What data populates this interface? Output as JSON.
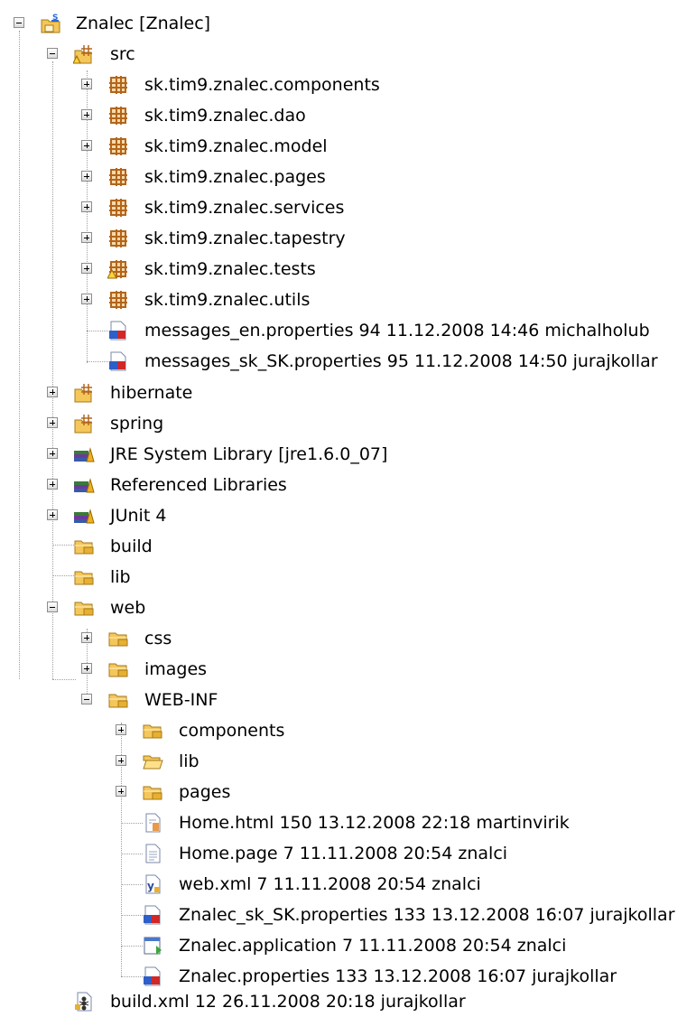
{
  "tree": {
    "root": {
      "label": "Znalec [Znalec]",
      "icon": "java-project-icon"
    },
    "src": {
      "label": "src",
      "icon": "source-folder-icon"
    },
    "packages": [
      {
        "label": "sk.tim9.znalec.components",
        "icon": "package-icon"
      },
      {
        "label": "sk.tim9.znalec.dao",
        "icon": "package-icon"
      },
      {
        "label": "sk.tim9.znalec.model",
        "icon": "package-icon"
      },
      {
        "label": "sk.tim9.znalec.pages",
        "icon": "package-icon"
      },
      {
        "label": "sk.tim9.znalec.services",
        "icon": "package-icon"
      },
      {
        "label": "sk.tim9.znalec.tapestry",
        "icon": "package-icon"
      },
      {
        "label": "sk.tim9.znalec.tests",
        "icon": "package-warning-icon"
      },
      {
        "label": "sk.tim9.znalec.utils",
        "icon": "package-icon"
      }
    ],
    "src_files": [
      {
        "label": "messages_en.properties 94  11.12.2008 14:46  michalholub",
        "icon": "properties-file-icon"
      },
      {
        "label": "messages_sk_SK.properties 95  11.12.2008 14:50  jurajkollar",
        "icon": "properties-file-icon"
      }
    ],
    "hibernate": {
      "label": "hibernate",
      "icon": "source-folder-icon"
    },
    "spring": {
      "label": "spring",
      "icon": "source-folder-icon"
    },
    "jre": {
      "label": "JRE System Library [jre1.6.0_07]",
      "icon": "library-icon"
    },
    "reflibs": {
      "label": "Referenced Libraries",
      "icon": "library-icon"
    },
    "junit": {
      "label": "JUnit 4",
      "icon": "library-icon"
    },
    "build": {
      "label": "build",
      "icon": "folder-icon"
    },
    "lib": {
      "label": "lib",
      "icon": "folder-icon"
    },
    "web": {
      "label": "web",
      "icon": "folder-icon"
    },
    "web_children": [
      {
        "label": "css",
        "icon": "folder-icon"
      },
      {
        "label": "images",
        "icon": "folder-icon"
      }
    ],
    "webinf": {
      "label": "WEB-INF",
      "icon": "folder-icon"
    },
    "webinf_folders": [
      {
        "label": "components",
        "icon": "folder-icon"
      },
      {
        "label": "lib",
        "icon": "folder-open-icon"
      },
      {
        "label": "pages",
        "icon": "folder-icon"
      }
    ],
    "webinf_files": [
      {
        "label": "Home.html 150  13.12.2008 22:18  martinvirik",
        "icon": "html-file-icon"
      },
      {
        "label": "Home.page 7  11.11.2008 20:54  znalci",
        "icon": "text-file-icon"
      },
      {
        "label": "web.xml 7  11.11.2008 20:54  znalci",
        "icon": "xml-file-icon"
      },
      {
        "label": "Znalec_sk_SK.properties 133  13.12.2008 16:07  jurajkollar",
        "icon": "properties-file-icon"
      },
      {
        "label": "Znalec.application 7  11.11.2008 20:54  znalci",
        "icon": "application-file-icon"
      },
      {
        "label": "Znalec.properties 133  13.12.2008 16:07  jurajkollar",
        "icon": "properties-file-icon"
      }
    ],
    "buildxml": {
      "label": "build.xml 12  26.11.2008 20:18  jurajkollar",
      "icon": "ant-file-icon"
    }
  }
}
